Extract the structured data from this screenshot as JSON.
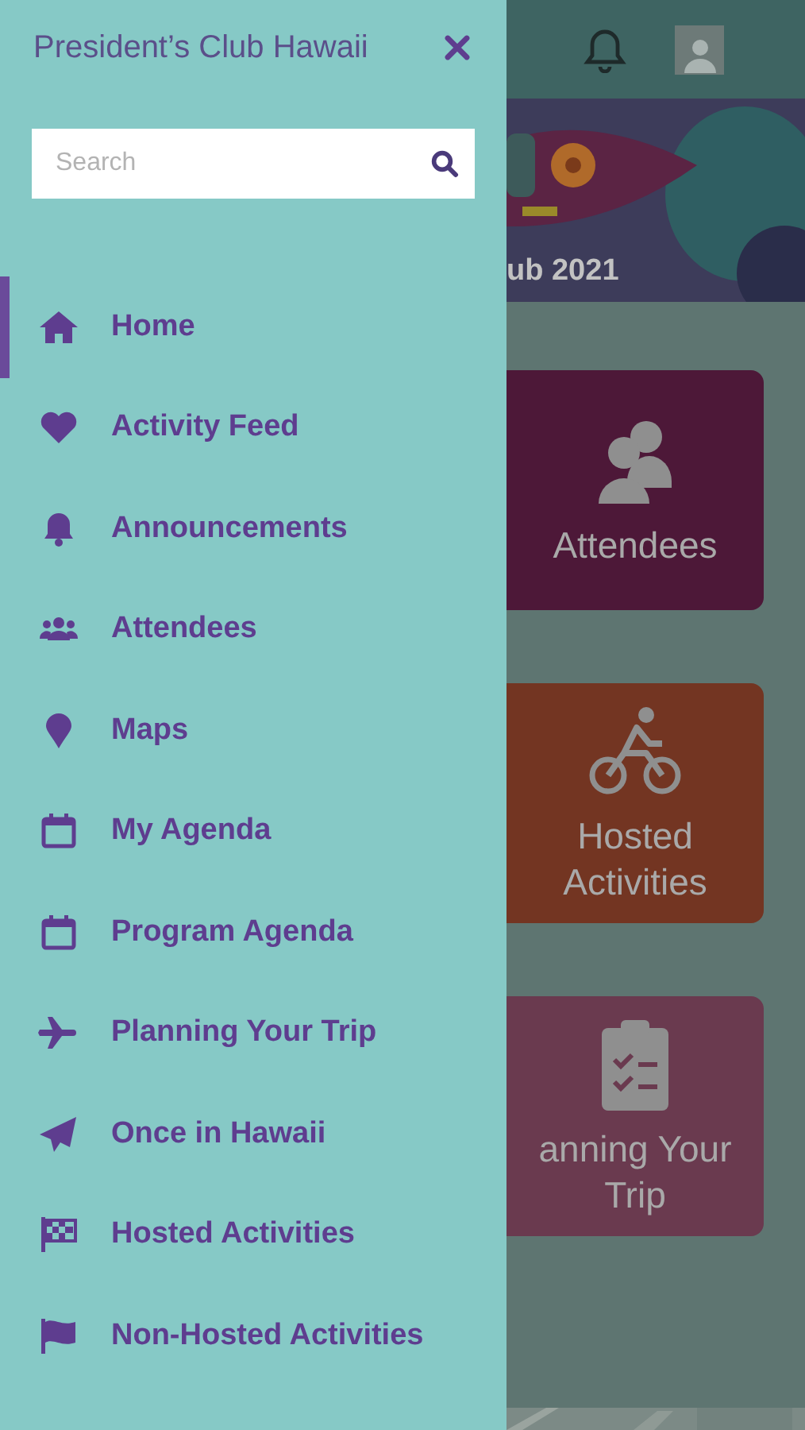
{
  "drawer": {
    "title": "President’s Club Hawaii",
    "search": {
      "placeholder": "Search"
    },
    "items": [
      {
        "label": "Home",
        "selected": true
      },
      {
        "label": "Activity Feed",
        "selected": false
      },
      {
        "label": "Announcements",
        "selected": false
      },
      {
        "label": "Attendees",
        "selected": false
      },
      {
        "label": "Maps",
        "selected": false
      },
      {
        "label": "My Agenda",
        "selected": false
      },
      {
        "label": "Program Agenda",
        "selected": false
      },
      {
        "label": "Planning Your Trip",
        "selected": false
      },
      {
        "label": "Once in Hawaii",
        "selected": false
      },
      {
        "label": "Hosted Activities",
        "selected": false
      },
      {
        "label": "Non-Hosted Activities",
        "selected": false
      }
    ]
  },
  "main": {
    "banner": {
      "caption": "ub 2021"
    },
    "tiles": [
      {
        "label": "Attendees",
        "color": "#4d1838"
      },
      {
        "label": "Hosted Activities",
        "color": "#733522"
      },
      {
        "label": "anning Your Trip",
        "color": "#6a3a4f"
      }
    ]
  }
}
